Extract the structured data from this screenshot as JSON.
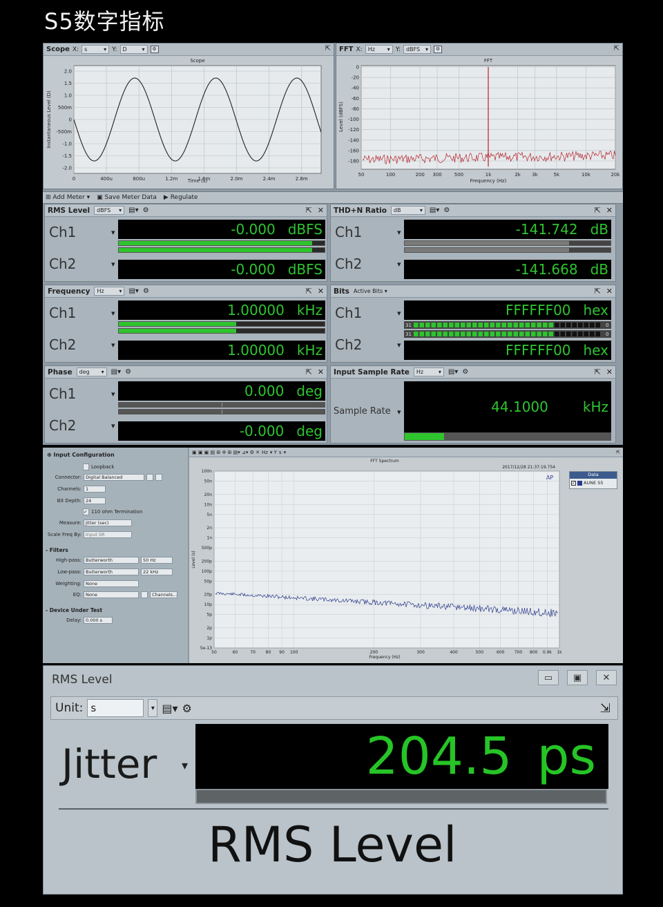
{
  "page_title": "S5数字指标",
  "scope": {
    "name": "Scope",
    "x_label": "X:",
    "x_unit": "s",
    "y_label": "Y:",
    "y_unit": "D",
    "plot_title": "Scope",
    "ylabel": "Instantaneous Level (D)",
    "xlabel": "Time (s)",
    "yticks": [
      "2.0",
      "1.5",
      "1.0",
      "500m",
      "0",
      "-500m",
      "-1.0",
      "-1.5",
      "-2.0"
    ],
    "xticks": [
      "0",
      "400u",
      "800u",
      "1.2m",
      "1.6m",
      "2.0m",
      "2.4m",
      "2.8m"
    ]
  },
  "fft": {
    "name": "FFT",
    "x_label": "X:",
    "x_unit": "Hz",
    "y_label": "Y:",
    "y_unit": "dBFS",
    "plot_title": "FFT",
    "ylabel": "Level (dBFS)",
    "xlabel": "Frequency (Hz)",
    "yticks": [
      "0",
      "-20",
      "-40",
      "-60",
      "-80",
      "-100",
      "-120",
      "-140",
      "-160",
      "-180"
    ],
    "xticks": [
      "50",
      "100",
      "200",
      "300",
      "500",
      "1k",
      "2k",
      "3k",
      "5k",
      "10k",
      "20k"
    ]
  },
  "toolbar": {
    "add_meter": "Add Meter",
    "save_meter": "Save Meter Data",
    "regulate": "Regulate"
  },
  "meters": {
    "rms": {
      "title": "RMS Level",
      "unit": "dBFS",
      "ch1": "Ch1",
      "ch2": "Ch2",
      "v1": "-0.000",
      "v2": "-0.000",
      "u1": "dBFS",
      "u2": "dBFS"
    },
    "thdn": {
      "title": "THD+N Ratio",
      "unit": "dB",
      "ch1": "Ch1",
      "ch2": "Ch2",
      "v1": "-141.742",
      "v2": "-141.668",
      "u1": "dB",
      "u2": "dB"
    },
    "freq": {
      "title": "Frequency",
      "unit": "Hz",
      "ch1": "Ch1",
      "ch2": "Ch2",
      "v1": "1.00000",
      "v2": "1.00000",
      "u1": "kHz",
      "u2": "kHz"
    },
    "bits": {
      "title": "Bits",
      "unit": "Active Bits",
      "ch1": "Ch1",
      "ch2": "Ch2",
      "v1": "FFFFFF00",
      "v2": "FFFFFF00",
      "u1": "hex",
      "u2": "hex",
      "b_hi": "31",
      "b_lo": "0"
    },
    "phase": {
      "title": "Phase",
      "unit": "deg",
      "ch1": "Ch1",
      "ch2": "Ch2",
      "v1": "0.000",
      "v2": "-0.000",
      "u1": "deg",
      "u2": "deg"
    },
    "isr": {
      "title": "Input Sample Rate",
      "unit": "Hz",
      "label": "Sample Rate",
      "value": "44.1000",
      "vunit": "kHz"
    }
  },
  "input_config": {
    "title": "Input Configuration",
    "loopback": "Loopback",
    "connector_label": "Connector:",
    "connector": "Digital Balanced",
    "channels_label": "Channels:",
    "channels": "1",
    "bitdepth_label": "Bit Depth:",
    "bitdepth": "24",
    "termination": "110 ohm Termination",
    "measure_label": "Measure:",
    "measure": "Jitter (sec)",
    "scale_label": "Scale Freq By:",
    "scale": "Input SR",
    "filters": "Filters",
    "hp_label": "High-pass:",
    "hp": "Butterworth",
    "hp_val": "50 Hz",
    "lp_label": "Low-pass:",
    "lp": "Butterworth",
    "lp_val": "22 kHz",
    "weighting_label": "Weighting:",
    "weighting": "None",
    "eq_label": "EQ:",
    "eq": "None",
    "channels_btn": "Channels...",
    "dut": "Device Under Test",
    "delay_label": "Delay:",
    "delay": "0.000 s"
  },
  "spectrum": {
    "title": "FFT Spectrum",
    "timestamp": "2017/12/28 21:37:19.754",
    "x_unit": "Hz",
    "y_unit": "s",
    "ylabel": "Level (s)",
    "xlabel": "Frequency (Hz)",
    "yticks": [
      "100n",
      "50n",
      "20n",
      "10n",
      "5n",
      "2n",
      "1n",
      "500p",
      "200p",
      "100p",
      "50p",
      "20p",
      "10p",
      "5p",
      "2p",
      "1p",
      "5e-13"
    ],
    "xticks": [
      "50",
      "60",
      "70",
      "80",
      "90",
      "100",
      "200",
      "300",
      "400",
      "500",
      "600",
      "700",
      "800",
      "0.9k",
      "1k"
    ],
    "legend_title": "Data",
    "legend_item": "AUNE S5"
  },
  "rms_window": {
    "title": "RMS Level",
    "unit_label": "Unit:",
    "unit": "s",
    "measure": "Jitter",
    "value": "204.5",
    "value_unit": "ps",
    "footer": "RMS Level"
  },
  "colors": {
    "display_green": "#2ec42e",
    "fft_red": "#b3222a",
    "spectrum_blue": "#2a3a8a"
  }
}
